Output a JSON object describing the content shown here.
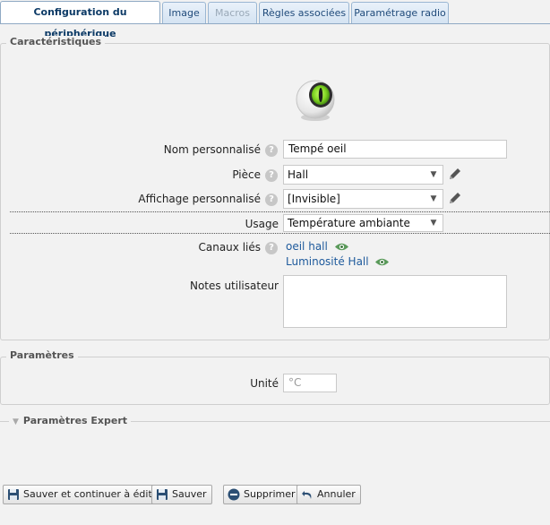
{
  "tabs": [
    {
      "label": "Configuration du périphérique",
      "state": "active"
    },
    {
      "label": "Image",
      "state": "normal"
    },
    {
      "label": "Macros",
      "state": "disabled"
    },
    {
      "label": "Règles associées",
      "state": "normal"
    },
    {
      "label": "Paramétrage radio",
      "state": "normal"
    }
  ],
  "caracteristiques": {
    "legend": "Caractéristiques",
    "device_icon": "green-eye-sensor-icon",
    "nom_label": "Nom personnalisé",
    "nom_value": "Tempé oeil",
    "piece_label": "Pièce",
    "piece_value": "Hall",
    "affichage_label": "Affichage personnalisé",
    "affichage_value": "[Invisible]",
    "usage_label": "Usage",
    "usage_value": "Température ambiante",
    "canaux_label": "Canaux liés",
    "canaux": [
      "oeil hall",
      "Luminosité Hall"
    ],
    "notes_label": "Notes utilisateur",
    "notes_value": ""
  },
  "parametres": {
    "legend": "Paramètres",
    "unite_label": "Unité",
    "unite_placeholder": "°C"
  },
  "expert": {
    "legend": "Paramètres Expert"
  },
  "help_glyph": "?",
  "buttons": [
    {
      "label": "Sauver et continuer à éditer",
      "icon": "floppy-icon"
    },
    {
      "label": "Sauver",
      "icon": "floppy-icon"
    },
    {
      "label": "Supprimer",
      "icon": "minus-circle-icon"
    },
    {
      "label": "Annuler",
      "icon": "undo-icon"
    }
  ],
  "colors": {
    "accent": "#1e5a9c",
    "tab_border": "#8fa9c4",
    "eye_green": "#7ed321"
  }
}
